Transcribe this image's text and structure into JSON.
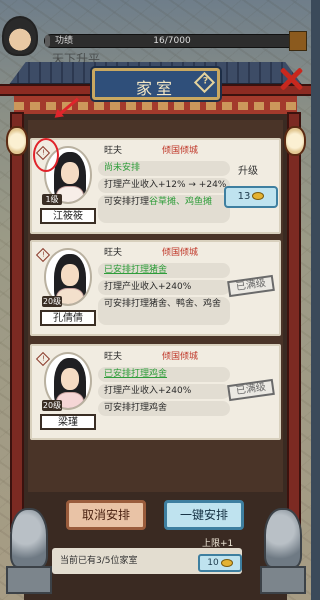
{
  "status": {
    "label": "功绩",
    "value": "16/7000",
    "progress": 0.002
  },
  "background_text": "天下升平",
  "title": "家室",
  "help_symbol": "?",
  "cards": [
    {
      "level": "1级",
      "name": "江筱筱",
      "husband_label": "旺夫",
      "trait": "倾国倾城",
      "status": "尚未安排",
      "income": "打理产业收入+12% → +24%",
      "assign_prefix": "可安排打理",
      "assign_targets": "谷草摊、鸡鱼摊",
      "upgrade_label": "升级",
      "upgrade_cost": "13",
      "maxed": null
    },
    {
      "level": "20级",
      "name": "孔倩倩",
      "husband_label": "旺夫",
      "trait": "倾国倾城",
      "status": "已安排打理猪舍",
      "income": "打理产业收入+240%",
      "assign_prefix": "可安排打理猪舍、鸭舍、鸡舍",
      "assign_targets": "",
      "upgrade_label": null,
      "upgrade_cost": null,
      "maxed": "已满级"
    },
    {
      "level": "20级",
      "name": "梁瑾",
      "husband_label": "旺夫",
      "trait": "倾国倾城",
      "status": "已安排打理鸡舍",
      "income": "打理产业收入+240%",
      "assign_prefix": "可安排打理鸡舍",
      "assign_targets": "",
      "upgrade_label": null,
      "upgrade_cost": null,
      "maxed": "已满级"
    }
  ],
  "buttons": {
    "cancel": "取消安排",
    "one_click": "一键安排"
  },
  "footer": {
    "count_text": "当前已有3/5位家室",
    "limit_label": "上限+1",
    "limit_cost": "10"
  },
  "colors": {
    "accent_red": "#c0392b",
    "accent_green": "#2f9d3a",
    "blue_button": "#bfe3ef"
  }
}
